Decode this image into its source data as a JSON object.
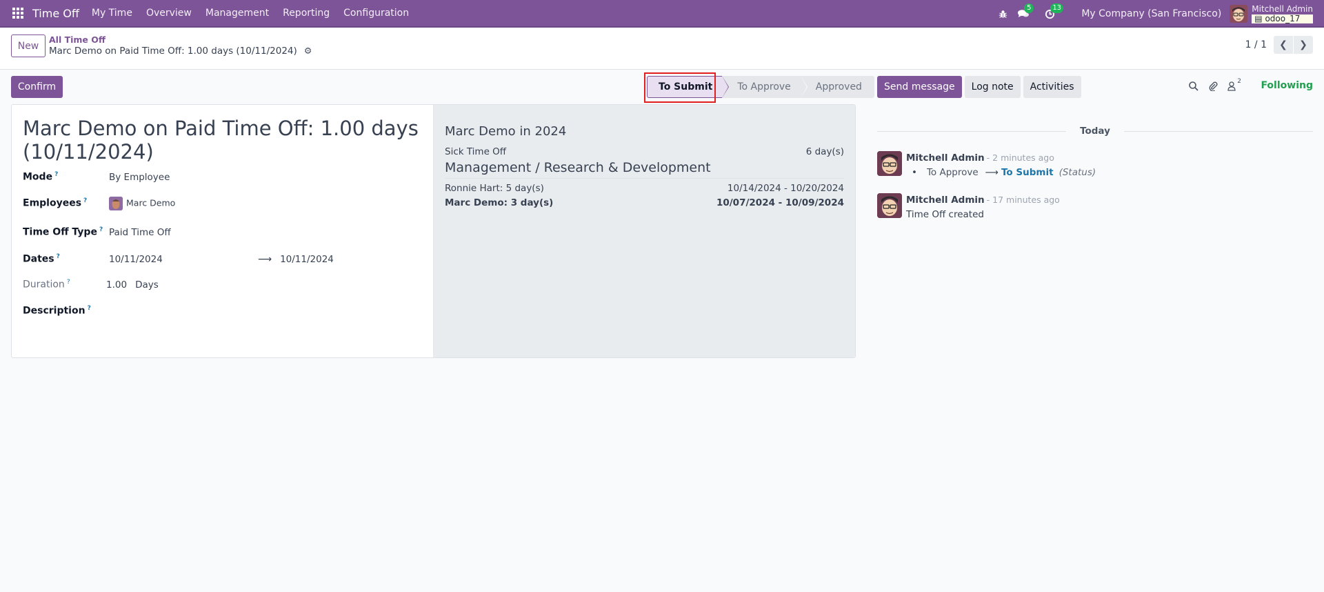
{
  "navbar": {
    "app_name": "Time Off",
    "menu": [
      "My Time",
      "Overview",
      "Management",
      "Reporting",
      "Configuration"
    ],
    "messages_count": "5",
    "activities_count": "13",
    "company": "My Company (San Francisco)",
    "user_name": "Mitchell Admin",
    "database": "odoo_17",
    "icons": [
      "apps-grid-icon",
      "bug-icon",
      "chat-icon",
      "clock-icon",
      "database-icon"
    ]
  },
  "control_panel": {
    "new_label": "New",
    "breadcrumb_parent": "All Time Off",
    "breadcrumb_current": "Marc Demo on Paid Time Off: 1.00 days (10/11/2024)",
    "pager": "1 / 1"
  },
  "statusbar": {
    "confirm_label": "Confirm",
    "stages": [
      "To Submit",
      "To Approve",
      "Approved"
    ],
    "current_stage": "To Submit"
  },
  "form": {
    "title": "Marc Demo on Paid Time Off: 1.00 days (10/11/2024)",
    "fields": {
      "mode": {
        "label": "Mode",
        "value": "By Employee"
      },
      "employees": {
        "label": "Employees",
        "value": "Marc Demo"
      },
      "time_off_type": {
        "label": "Time Off Type",
        "value": "Paid Time Off"
      },
      "dates": {
        "label": "Dates",
        "from": "10/11/2024",
        "to": "10/11/2024"
      },
      "duration": {
        "label": "Duration",
        "value": "1.00",
        "unit": "Days"
      },
      "description": {
        "label": "Description",
        "value": ""
      }
    },
    "help_mark": "?"
  },
  "side_panel": {
    "title": "Marc Demo in 2024",
    "summary": [
      {
        "label": "Sick Time Off",
        "value": "6 day(s)"
      }
    ],
    "department_title": "Management / Research & Development",
    "department_rows": [
      {
        "label": "Ronnie Hart: 5 day(s)",
        "value": "10/14/2024 - 10/20/2024",
        "bold": false
      },
      {
        "label": "Marc Demo: 3 day(s)",
        "value": "10/07/2024 - 10/09/2024",
        "bold": true
      }
    ]
  },
  "chatter": {
    "send_message": "Send message",
    "log_note": "Log note",
    "activities": "Activities",
    "followers_count": "2",
    "following_label": "Following",
    "date_separator": "Today",
    "messages": [
      {
        "author": "Mitchell Admin",
        "time": "- 2 minutes ago",
        "tracking": {
          "old": "To Approve",
          "new": "To Submit",
          "field": "(Status)"
        }
      },
      {
        "author": "Mitchell Admin",
        "time": "- 17 minutes ago",
        "text": "Time Off created"
      }
    ]
  },
  "colors": {
    "brand": "#7c5497",
    "success": "#21a050",
    "link": "#1d75a8",
    "highlight": "#e11d1d"
  }
}
